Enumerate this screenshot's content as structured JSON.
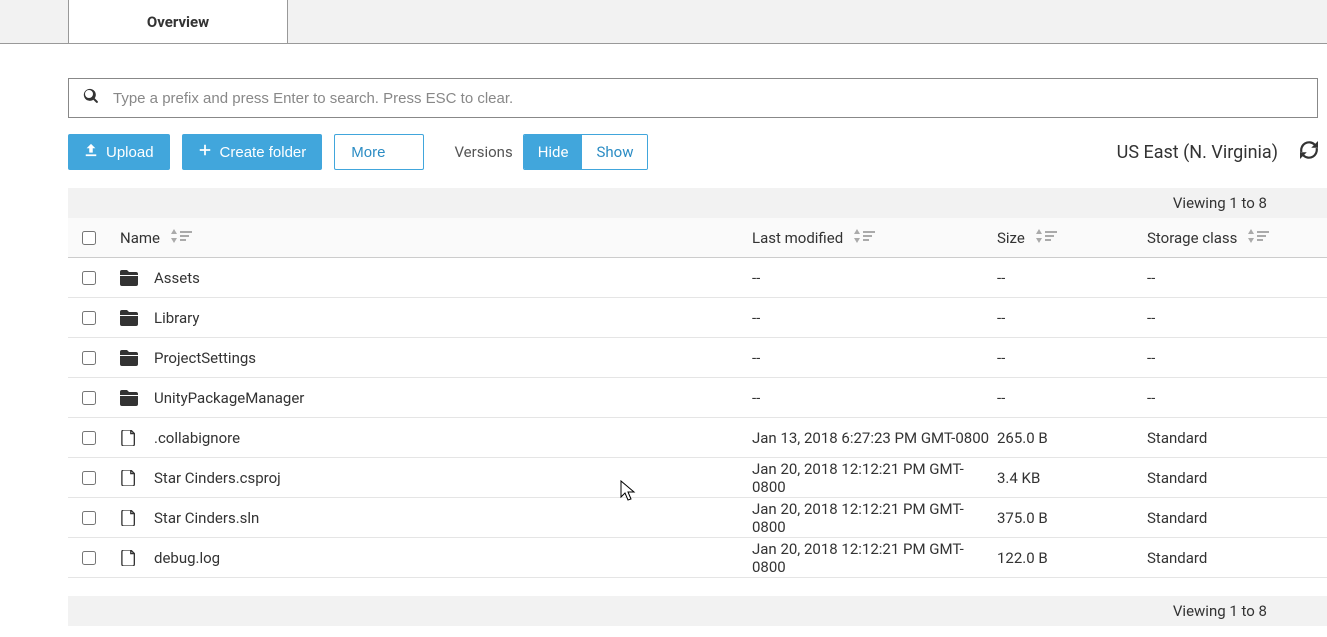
{
  "tabs": {
    "overview": "Overview"
  },
  "search": {
    "placeholder": "Type a prefix and press Enter to search. Press ESC to clear."
  },
  "toolbar": {
    "upload": "Upload",
    "create_folder": "Create folder",
    "more": "More",
    "versions_label": "Versions",
    "hide": "Hide",
    "show": "Show",
    "region": "US East (N. Virginia)"
  },
  "status": {
    "viewing_top": "Viewing 1 to 8",
    "viewing_bottom": "Viewing 1 to 8"
  },
  "columns": {
    "name": "Name",
    "last_modified": "Last modified",
    "size": "Size",
    "storage_class": "Storage class"
  },
  "items": [
    {
      "type": "folder",
      "name": "Assets",
      "last_modified": "--",
      "size": "--",
      "storage_class": "--"
    },
    {
      "type": "folder",
      "name": "Library",
      "last_modified": "--",
      "size": "--",
      "storage_class": "--"
    },
    {
      "type": "folder",
      "name": "ProjectSettings",
      "last_modified": "--",
      "size": "--",
      "storage_class": "--"
    },
    {
      "type": "folder",
      "name": "UnityPackageManager",
      "last_modified": "--",
      "size": "--",
      "storage_class": "--"
    },
    {
      "type": "file",
      "name": ".collabignore",
      "last_modified": "Jan 13, 2018 6:27:23 PM GMT-0800",
      "size": "265.0 B",
      "storage_class": "Standard"
    },
    {
      "type": "file",
      "name": "Star Cinders.csproj",
      "last_modified": "Jan 20, 2018 12:12:21 PM GMT-0800",
      "size": "3.4 KB",
      "storage_class": "Standard"
    },
    {
      "type": "file",
      "name": "Star Cinders.sln",
      "last_modified": "Jan 20, 2018 12:12:21 PM GMT-0800",
      "size": "375.0 B",
      "storage_class": "Standard"
    },
    {
      "type": "file",
      "name": "debug.log",
      "last_modified": "Jan 20, 2018 12:12:21 PM GMT-0800",
      "size": "122.0 B",
      "storage_class": "Standard"
    }
  ]
}
